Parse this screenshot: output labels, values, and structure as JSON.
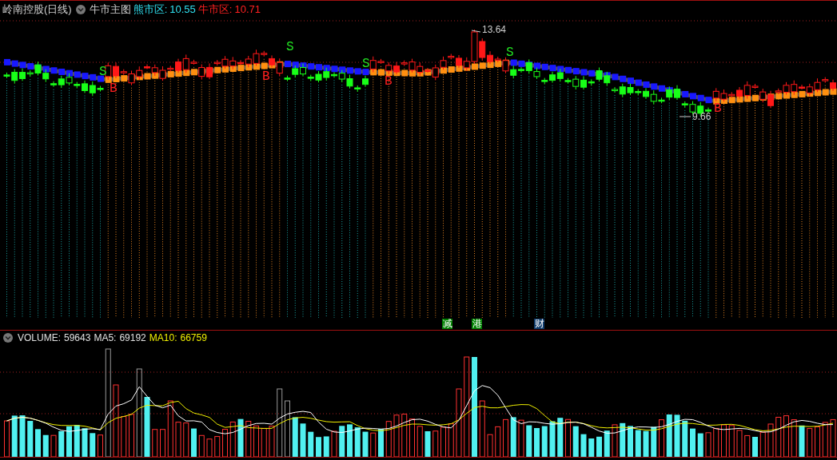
{
  "header": {
    "stock": "岭南控股(日线)",
    "indicator": "牛市主图",
    "bear_label": "熊市区:",
    "bear_value": "10.55",
    "bull_label": "牛市区:",
    "bull_value": "10.71"
  },
  "signals": [
    {
      "text": "S",
      "kind": "sell"
    },
    {
      "text": "B",
      "kind": "buy"
    },
    {
      "text": "B",
      "kind": "buy"
    },
    {
      "text": "S",
      "kind": "sell"
    },
    {
      "text": "S",
      "kind": "sell"
    },
    {
      "text": "B",
      "kind": "buy"
    },
    {
      "text": "S",
      "kind": "sell"
    },
    {
      "text": "B",
      "kind": "buy"
    }
  ],
  "price_labels": [
    {
      "text": "13.64",
      "kind": "high"
    },
    {
      "text": "9.66",
      "kind": "low"
    }
  ],
  "event_tags": [
    {
      "text": "减",
      "color": "#008000"
    },
    {
      "text": "港",
      "color": "#008000"
    },
    {
      "text": "财",
      "color": "#103c6c"
    }
  ],
  "volume_header": {
    "volume_label": "VOLUME:",
    "volume_value": "59643",
    "ma5_label": "MA5:",
    "ma5_value": "69192",
    "ma10_label": "MA10:",
    "ma10_value": "66759"
  }
}
